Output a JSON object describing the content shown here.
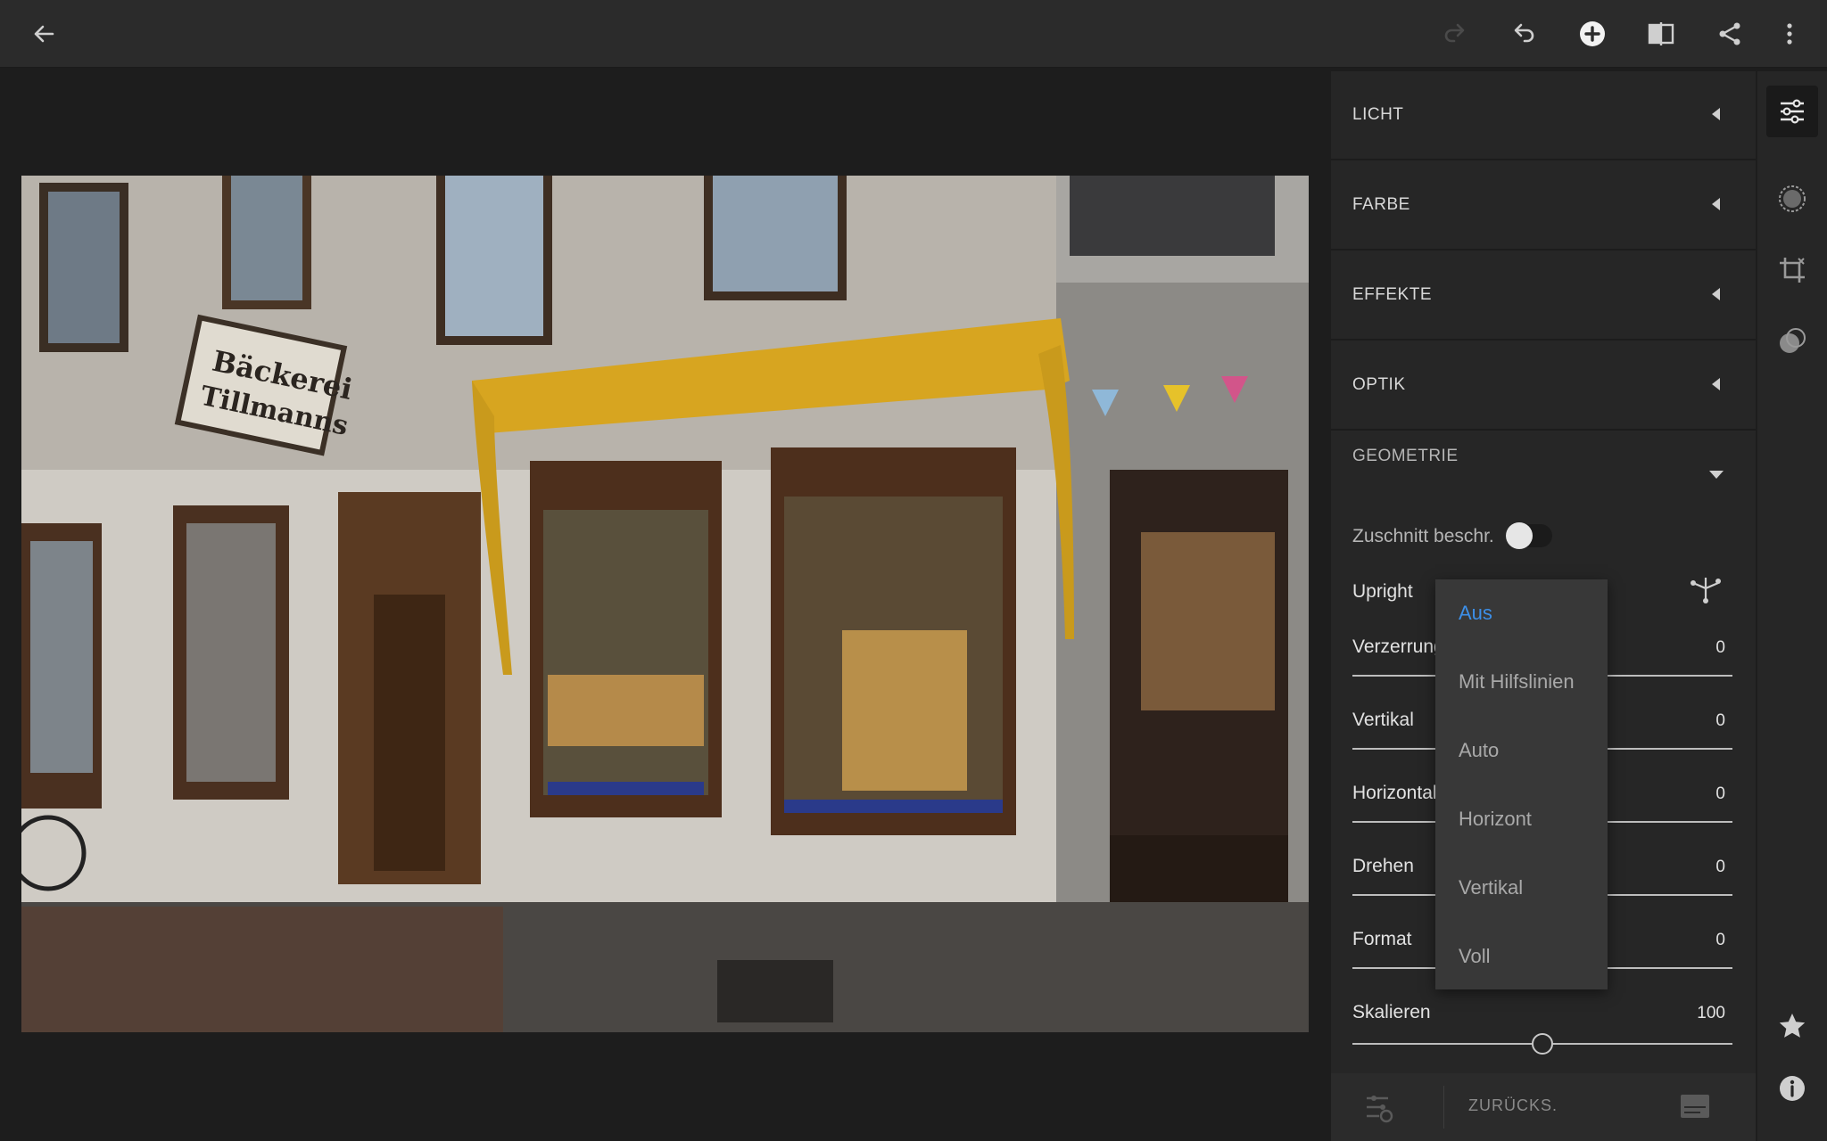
{
  "topbar": {
    "back_icon": "arrow-left-icon",
    "redo_icon": "redo-icon",
    "undo_icon": "undo-icon",
    "add_icon": "plus-circle-icon",
    "compare_icon": "compare-split-icon",
    "share_icon": "share-icon",
    "more_icon": "more-vertical-icon"
  },
  "photo": {
    "description_icon": "storefront-photo"
  },
  "panel": {
    "sections": [
      {
        "title": "LICHT"
      },
      {
        "title": "FARBE"
      },
      {
        "title": "EFFEKTE"
      },
      {
        "title": "OPTIK"
      },
      {
        "title": "GEOMETRIE"
      }
    ],
    "geometry": {
      "crop_limit_label": "Zuschnitt beschr.",
      "crop_limit_on": false,
      "upright_label": "Upright",
      "sliders": [
        {
          "label": "Verzerrung",
          "value": "0"
        },
        {
          "label": "Vertikal",
          "value": "0"
        },
        {
          "label": "Horizontal",
          "value": "0"
        },
        {
          "label": "Drehen",
          "value": "0"
        },
        {
          "label": "Format",
          "value": "0"
        },
        {
          "label": "Skalieren",
          "value": "100"
        }
      ],
      "scale_fraction": 0.5
    },
    "bottom": {
      "reset_label": "ZURÜCKS."
    }
  },
  "upright_menu": {
    "items": [
      "Aus",
      "Mit Hilfslinien",
      "Auto",
      "Horizont",
      "Vertikal",
      "Voll"
    ],
    "selected": "Aus"
  },
  "colors": {
    "accent": "#3c8fe8",
    "panel_bg": "#262626",
    "topbar_bg": "#2b2b2b"
  }
}
